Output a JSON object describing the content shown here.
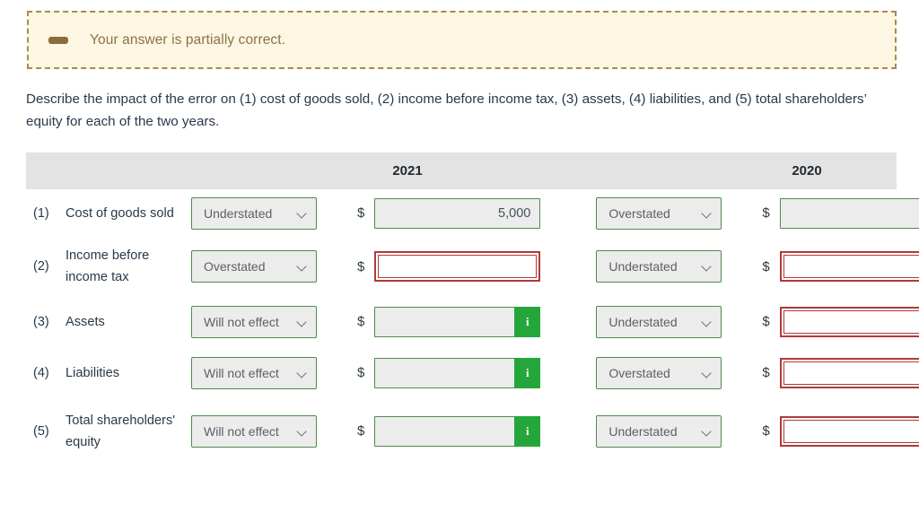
{
  "alert": {
    "icon": "minus-dash-icon",
    "message": "Your answer is partially correct.",
    "background_color": "#fdf6e3",
    "border_color": "#a98b4c",
    "text_color": "#8a7348"
  },
  "prompt": {
    "text": "Describe the impact of the error on (1) cost of goods sold, (2) income before income tax, (3) assets, (4) liabilities, and (5) total shareholders’ equity for each of the two years."
  },
  "table": {
    "header": {
      "blank": "",
      "year_2021": "2021",
      "year_2020": "2020"
    },
    "currency_symbol": "$",
    "info_badge_glyph": "i",
    "colors": {
      "header_bg": "#e3e3e3",
      "field_bg": "#ececec",
      "valid_border": "#4f8a4f",
      "error_border": "#b03a3a",
      "info_badge": "#25a63a"
    },
    "rows": [
      {
        "num": "(1)",
        "label": "Cost of goods sold",
        "y2021": {
          "select": "Understated",
          "amount": "5,000",
          "state": "valid",
          "info": false
        },
        "y2020": {
          "select": "Overstated",
          "amount": "",
          "state": "valid",
          "info": false
        }
      },
      {
        "num": "(2)",
        "label": "Income before income tax",
        "y2021": {
          "select": "Overstated",
          "amount": "",
          "state": "error",
          "info": false
        },
        "y2020": {
          "select": "Understated",
          "amount": "",
          "state": "error",
          "info": false
        }
      },
      {
        "num": "(3)",
        "label": "Assets",
        "y2021": {
          "select": "Will not effect",
          "amount": "",
          "state": "valid",
          "info": true
        },
        "y2020": {
          "select": "Understated",
          "amount": "",
          "state": "error",
          "info": false
        }
      },
      {
        "num": "(4)",
        "label": "Liabilities",
        "y2021": {
          "select": "Will not effect",
          "amount": "",
          "state": "valid",
          "info": true
        },
        "y2020": {
          "select": "Overstated",
          "amount": "",
          "state": "error",
          "info": false
        }
      },
      {
        "num": "(5)",
        "label": "Total shareholders' equity",
        "y2021": {
          "select": "Will not effect",
          "amount": "",
          "state": "valid",
          "info": true
        },
        "y2020": {
          "select": "Understated",
          "amount": "",
          "state": "error",
          "info": false
        }
      }
    ]
  }
}
